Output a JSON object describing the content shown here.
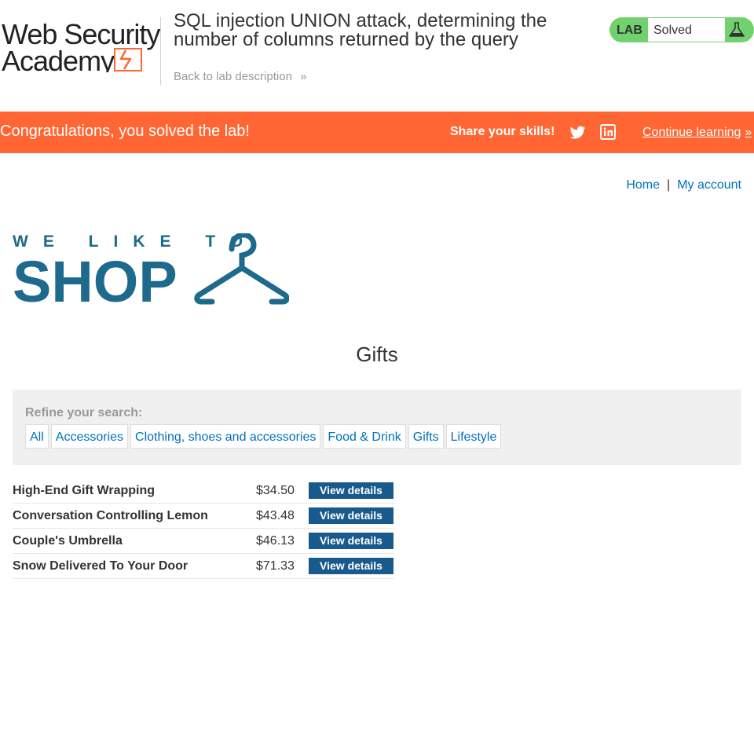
{
  "academy": {
    "logo_text_line1": "Web Security",
    "logo_text_line2": "Academy",
    "lab_title": "SQL injection UNION attack, determining the number of columns returned by the query",
    "back_link": "Back to lab description",
    "lab_label": "LAB",
    "lab_status": "Solved"
  },
  "banner": {
    "message": "Congratulations, you solved the lab!",
    "share_label": "Share your skills!",
    "continue_label": "Continue learning"
  },
  "nav": {
    "home": "Home",
    "separator": "|",
    "account": "My account"
  },
  "shop_logo": {
    "line1": "WE LIKE TO",
    "line2": "SHOP"
  },
  "page": {
    "heading": "Gifts"
  },
  "filters": {
    "label": "Refine your search:",
    "items": [
      "All",
      "Accessories",
      "Clothing, shoes and accessories",
      "Food & Drink",
      "Gifts",
      "Lifestyle"
    ]
  },
  "products": [
    {
      "name": "High-End Gift Wrapping",
      "price": "$34.50",
      "action": "View details"
    },
    {
      "name": "Conversation Controlling Lemon",
      "price": "$43.48",
      "action": "View details"
    },
    {
      "name": "Couple's Umbrella",
      "price": "$46.13",
      "action": "View details"
    },
    {
      "name": "Snow Delivered To Your Door",
      "price": "$71.33",
      "action": "View details"
    }
  ],
  "colors": {
    "banner": "#ff6633",
    "lab_status": "#70d16d",
    "link": "#0071bc",
    "button": "#185a8c",
    "shop_logo": "#1d6a8c"
  },
  "icons": {
    "back": "double-chevron-right-icon",
    "lab": "flask-icon",
    "twitter": "twitter-icon",
    "linkedin": "linkedin-icon",
    "continue": "double-chevron-right-icon",
    "shop": "hanger-icon"
  }
}
